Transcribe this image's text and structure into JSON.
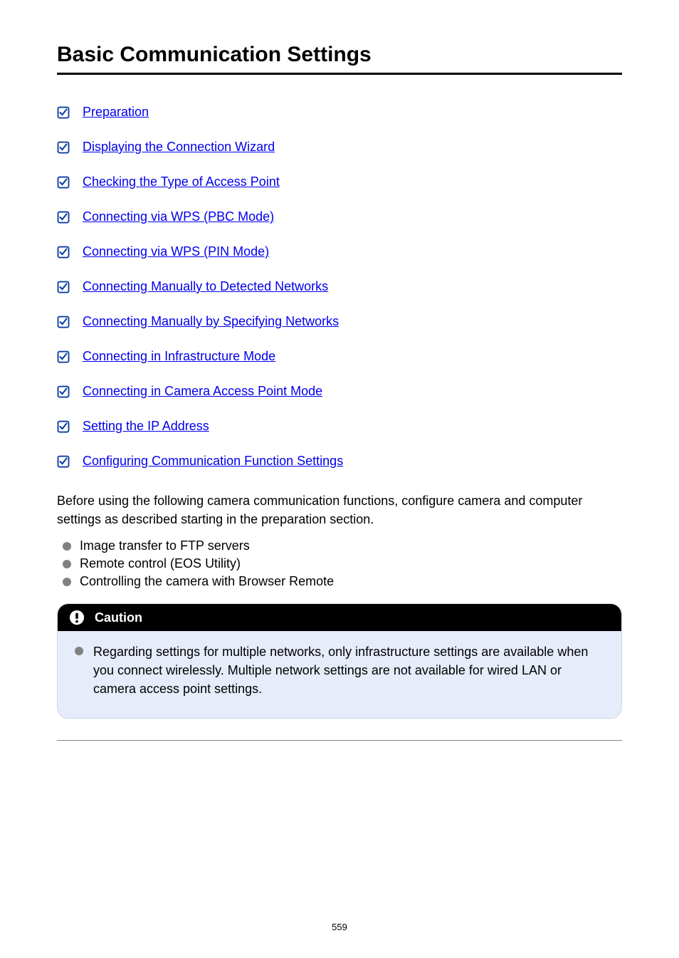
{
  "title": "Basic Communication Settings",
  "links": [
    {
      "label": "Preparation"
    },
    {
      "label": "Displaying the Connection Wizard"
    },
    {
      "label": "Checking the Type of Access Point"
    },
    {
      "label": "Connecting via WPS (PBC Mode)"
    },
    {
      "label": "Connecting via WPS (PIN Mode)"
    },
    {
      "label": "Connecting Manually to Detected Networks"
    },
    {
      "label": "Connecting Manually by Specifying Networks"
    },
    {
      "label": "Connecting in Infrastructure Mode"
    },
    {
      "label": "Connecting in Camera Access Point Mode"
    },
    {
      "label": "Setting the IP Address"
    },
    {
      "label": "Configuring Communication Function Settings"
    }
  ],
  "intro": "Before using the following camera communication functions, configure camera and computer settings as described starting in the preparation section.",
  "bullets": [
    "Image transfer to FTP servers",
    "Remote control (EOS Utility)",
    "Controlling the camera with Browser Remote"
  ],
  "caution": {
    "heading": "Caution",
    "text": "Regarding settings for multiple networks, only infrastructure settings are available when you connect wirelessly. Multiple network settings are not available for wired LAN or camera access point settings."
  },
  "page_number": "559"
}
